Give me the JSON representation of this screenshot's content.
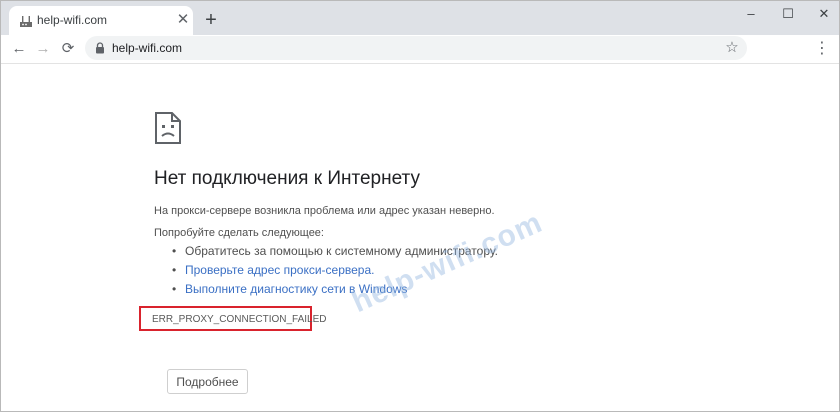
{
  "tab": {
    "title": "help-wifi.com",
    "close_icon": "close-icon",
    "new_tab": "+"
  },
  "window_controls": {
    "minimize": "–",
    "maximize": "☐",
    "close": "✕"
  },
  "toolbar": {
    "back": "←",
    "forward": "→",
    "reload": "⟳",
    "url": "help-wifi.com",
    "star": "☆",
    "menu": "⋮"
  },
  "error_page": {
    "heading": "Нет подключения к Интернету",
    "description": "На прокси-сервере возникла проблема или адрес указан неверно.",
    "try_label": "Попробуйте сделать следующее:",
    "suggestions": [
      {
        "text": "Обратитесь за помощью к системному администратору."
      },
      {
        "text": "Проверьте адрес прокси-сервера."
      },
      {
        "text": "Выполните диагностику сети в Windows"
      }
    ],
    "error_code": "ERR_PROXY_CONNECTION_FAILED",
    "details_button": "Подробнее"
  },
  "watermark": "help-wifi.com",
  "colors": {
    "link": "#3a6fc4",
    "highlight_border": "#d9232d",
    "tabstrip": "#dee1e6"
  }
}
